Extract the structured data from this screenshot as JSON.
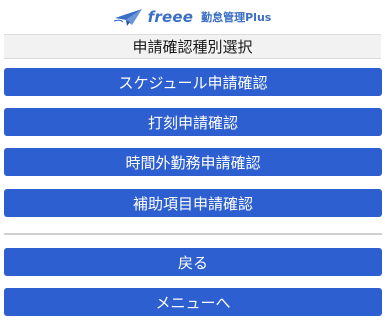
{
  "header": {
    "logo_brand": "freee",
    "logo_product": "勤怠管理Plus",
    "logo_icon": "paper-plane-icon",
    "brand_color": "#3a6fc4"
  },
  "page_title": "申請確認種別選択",
  "menu": {
    "schedule_label": "スケジュール申請確認",
    "punch_label": "打刻申請確認",
    "overtime_label": "時間外勤務申請確認",
    "supplementary_label": "補助項目申請確認"
  },
  "nav": {
    "back_label": "戻る",
    "to_menu_label": "メニューへ"
  },
  "colors": {
    "button": "#2d5fd0",
    "button_text": "#ffffff",
    "title_bg": "#f2f2f2"
  }
}
